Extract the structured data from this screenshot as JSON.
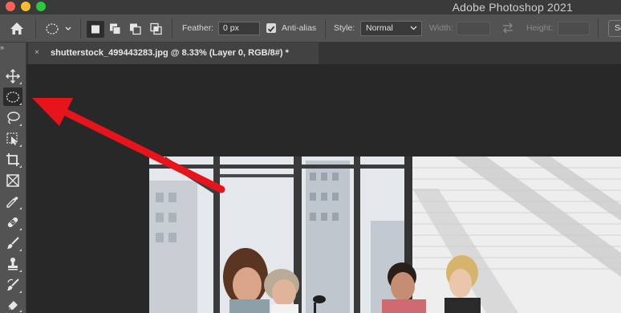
{
  "window": {
    "title": "Adobe Photoshop 2021"
  },
  "options_bar": {
    "feather_label": "Feather:",
    "feather_value": "0 px",
    "anti_alias_label": "Anti-alias",
    "anti_alias_checked": true,
    "style_label": "Style:",
    "style_value": "Normal",
    "width_label": "Width:",
    "height_label": "Height:",
    "select_mask_label": "Se"
  },
  "document_tab": {
    "title": "shutterstock_499443283.jpg @ 8.33% (Layer 0, RGB/8#) *",
    "close_glyph": "×"
  },
  "toolbar": {
    "collapse_glyph": "››",
    "tools": [
      "move-tool",
      "elliptical-marquee-tool",
      "lasso-tool",
      "object-selection-tool",
      "crop-tool",
      "frame-tool",
      "eyedropper-tool",
      "spot-healing-brush-tool",
      "brush-tool",
      "clone-stamp-tool",
      "history-brush-tool",
      "eraser-tool"
    ],
    "active_tool": "elliptical-marquee-tool"
  },
  "annotation": {
    "color": "#e8141b",
    "points_to": "elliptical-marquee-tool"
  }
}
